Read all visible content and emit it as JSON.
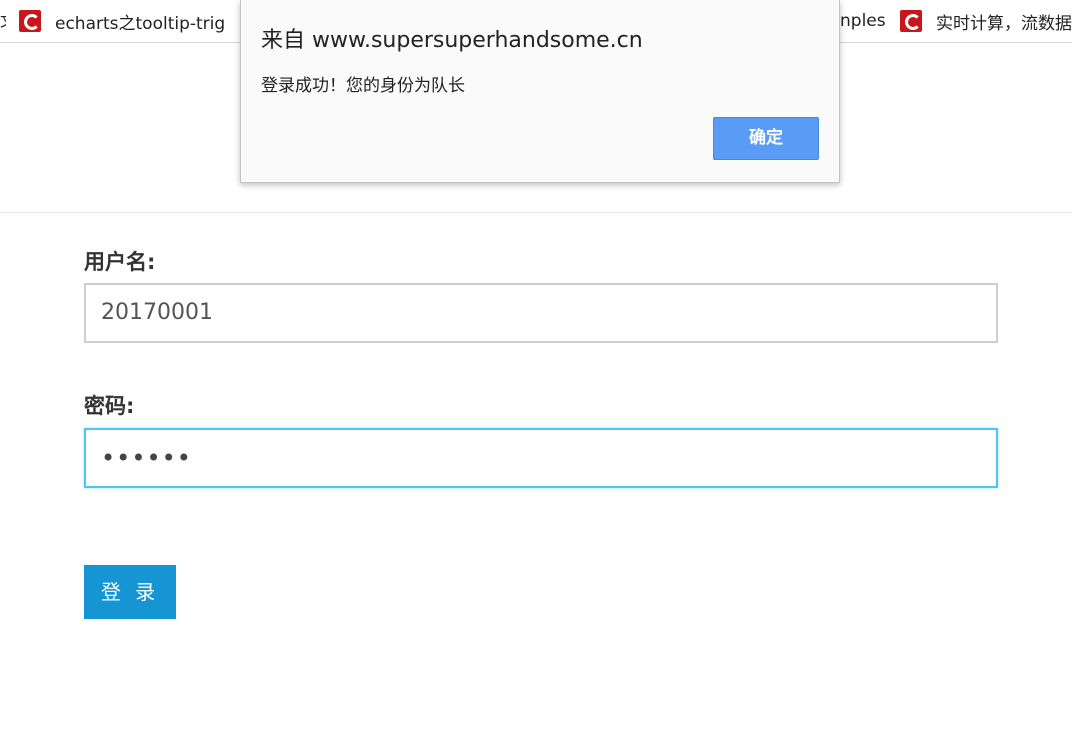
{
  "bookmarks_bar": {
    "cut_left_text": "文",
    "items": [
      {
        "label": "echarts之tooltip-trig",
        "icon": "csdn-favicon-icon"
      },
      {
        "label": "nples",
        "icon": ""
      },
      {
        "label": "实时计算，流数据",
        "icon": "csdn-favicon-icon"
      }
    ]
  },
  "form": {
    "username_label": "用户名:",
    "username_value": "20170001",
    "password_label": "密码:",
    "password_value": "••••••",
    "login_button": "登 录"
  },
  "alert": {
    "title": "来自 www.supersuperhandsome.cn",
    "message": "登录成功！您的身份为队长",
    "ok_button": "确定"
  },
  "colors": {
    "accent": "#1595d3",
    "dialog_button": "#5a9bf6",
    "focus_border": "#4fc3f7",
    "favicon": "#c8161d"
  }
}
